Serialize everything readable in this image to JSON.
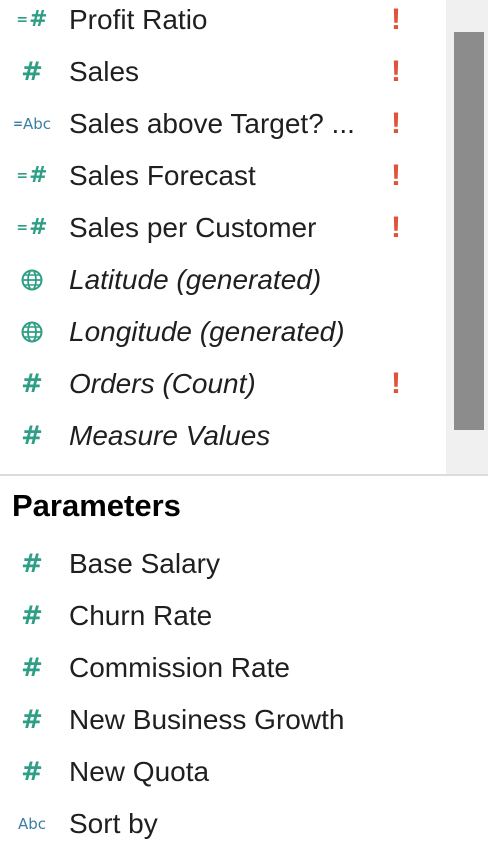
{
  "measures": {
    "items": [
      {
        "label": "Profit Ratio",
        "icon": "calculated-number-icon",
        "italic": false,
        "warning": true
      },
      {
        "label": "Sales",
        "icon": "number-icon",
        "italic": false,
        "warning": true
      },
      {
        "label": "Sales above Target? ...",
        "icon": "calculated-string-icon",
        "italic": false,
        "warning": true
      },
      {
        "label": "Sales Forecast",
        "icon": "calculated-number-icon",
        "italic": false,
        "warning": true
      },
      {
        "label": "Sales per Customer",
        "icon": "calculated-number-icon",
        "italic": false,
        "warning": true
      },
      {
        "label": "Latitude (generated)",
        "icon": "globe-icon",
        "italic": true,
        "warning": false
      },
      {
        "label": "Longitude (generated)",
        "icon": "globe-icon",
        "italic": true,
        "warning": false
      },
      {
        "label": "Orders (Count)",
        "icon": "number-icon",
        "italic": true,
        "warning": true
      },
      {
        "label": "Measure Values",
        "icon": "number-icon",
        "italic": true,
        "warning": false
      }
    ]
  },
  "parameters": {
    "heading": "Parameters",
    "items": [
      {
        "label": "Base Salary",
        "icon": "number-icon"
      },
      {
        "label": "Churn Rate",
        "icon": "number-icon"
      },
      {
        "label": "Commission Rate",
        "icon": "number-icon"
      },
      {
        "label": "New Business Growth",
        "icon": "number-icon"
      },
      {
        "label": "New Quota",
        "icon": "number-icon"
      },
      {
        "label": "Sort by",
        "icon": "string-icon"
      }
    ]
  },
  "glyphs": {
    "warning": "!",
    "hash": "#",
    "equals": "=",
    "abc": "Abc"
  },
  "colors": {
    "number_icon": "#2e9e86",
    "string_icon": "#3a7ea4",
    "warning": "#e0533a",
    "scrollbar_thumb": "#8c8c8c"
  }
}
